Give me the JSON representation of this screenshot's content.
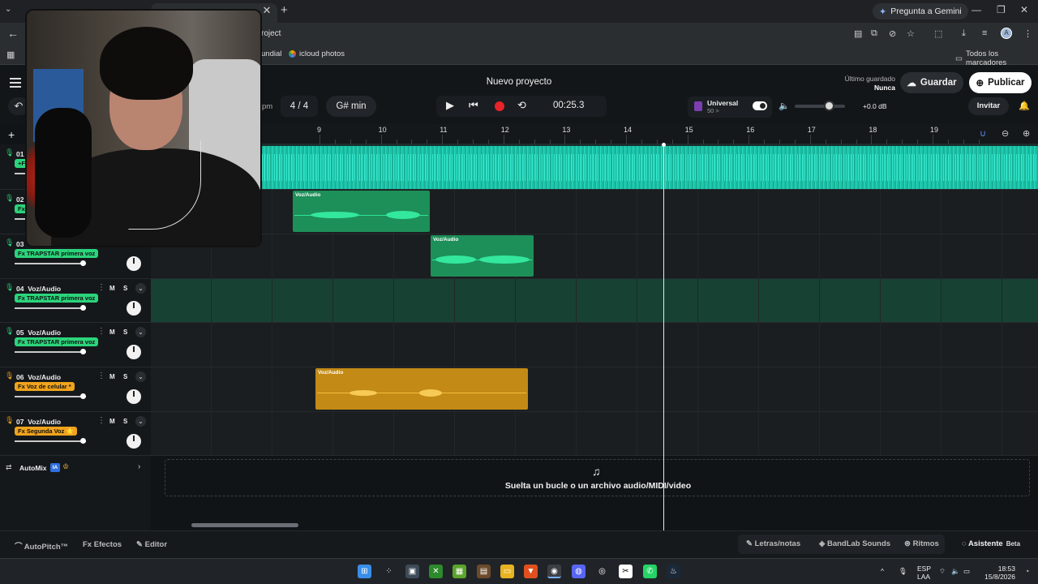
{
  "browser": {
    "gemini_label": "Pregunta a Gemini",
    "url_fragment": "roject",
    "bookmarks": [
      "undial",
      "icloud photos"
    ],
    "all_bookmarks": "Todos los marcadores"
  },
  "header": {
    "project_title": "Nuevo proyecto",
    "last_saved_label": "Último guardado",
    "last_saved_value": "Nunca",
    "save_label": "Guardar",
    "publish_label": "Publicar",
    "bpm_unit": "pm",
    "time_signature": "4 / 4",
    "key": "G# min",
    "time": "00:25.3",
    "universal_label": "Universal",
    "universal_sub": "50 >",
    "master_db": "+0.0 dB",
    "invite_label": "Invitar"
  },
  "ruler": {
    "bars": [
      "9",
      "10",
      "11",
      "12",
      "13",
      "14",
      "15",
      "16",
      "17",
      "18",
      "19"
    ]
  },
  "tracks": [
    {
      "num": "01",
      "name": "",
      "fx": "+F",
      "color": "green"
    },
    {
      "num": "02",
      "name": "",
      "fx": "Fx",
      "color": "green"
    },
    {
      "num": "03",
      "name": "",
      "fx": "Fx TRAPSTAR primera voz",
      "color": "green"
    },
    {
      "num": "04",
      "name": "Voz/Audio",
      "fx": "Fx TRAPSTAR primera voz",
      "color": "green"
    },
    {
      "num": "05",
      "name": "Voz/Audio",
      "fx": "Fx TRAPSTAR primera voz",
      "color": "green"
    },
    {
      "num": "06",
      "name": "Voz/Audio",
      "fx": "Fx Voz de celular *",
      "color": "orange"
    },
    {
      "num": "07",
      "name": "Voz/Audio",
      "fx": "Fx Segunda Voz ⭐",
      "color": "orange"
    }
  ],
  "track_buttons": {
    "mute": "M",
    "solo": "S"
  },
  "clips": {
    "clip2": "Voz/Audio",
    "clip3": "Voz/Audio",
    "clip6": "Voz/Audio"
  },
  "automix": {
    "label": "AutoMix",
    "badge": "IA"
  },
  "dropzone": {
    "text": "Suelta un bucle o un archivo audio/MIDI/video"
  },
  "bottom": {
    "autopitch": "AutoPitch™",
    "effects": "Efectos",
    "editor": "Editor",
    "lyrics": "Letras/notas",
    "sounds": "BandLab Sounds",
    "beats": "Ritmos",
    "assistant": "Asistente",
    "beta": "Beta"
  },
  "taskbar": {
    "lang1": "ESP",
    "lang2": "LAA",
    "clock_time": "18:53",
    "clock_date": "15/8/2026"
  },
  "colors": {
    "accent_green": "#2bd47b",
    "accent_orange": "#f0a31c",
    "record_red": "#e8232a",
    "waveform_teal": "#1cc2a8"
  }
}
